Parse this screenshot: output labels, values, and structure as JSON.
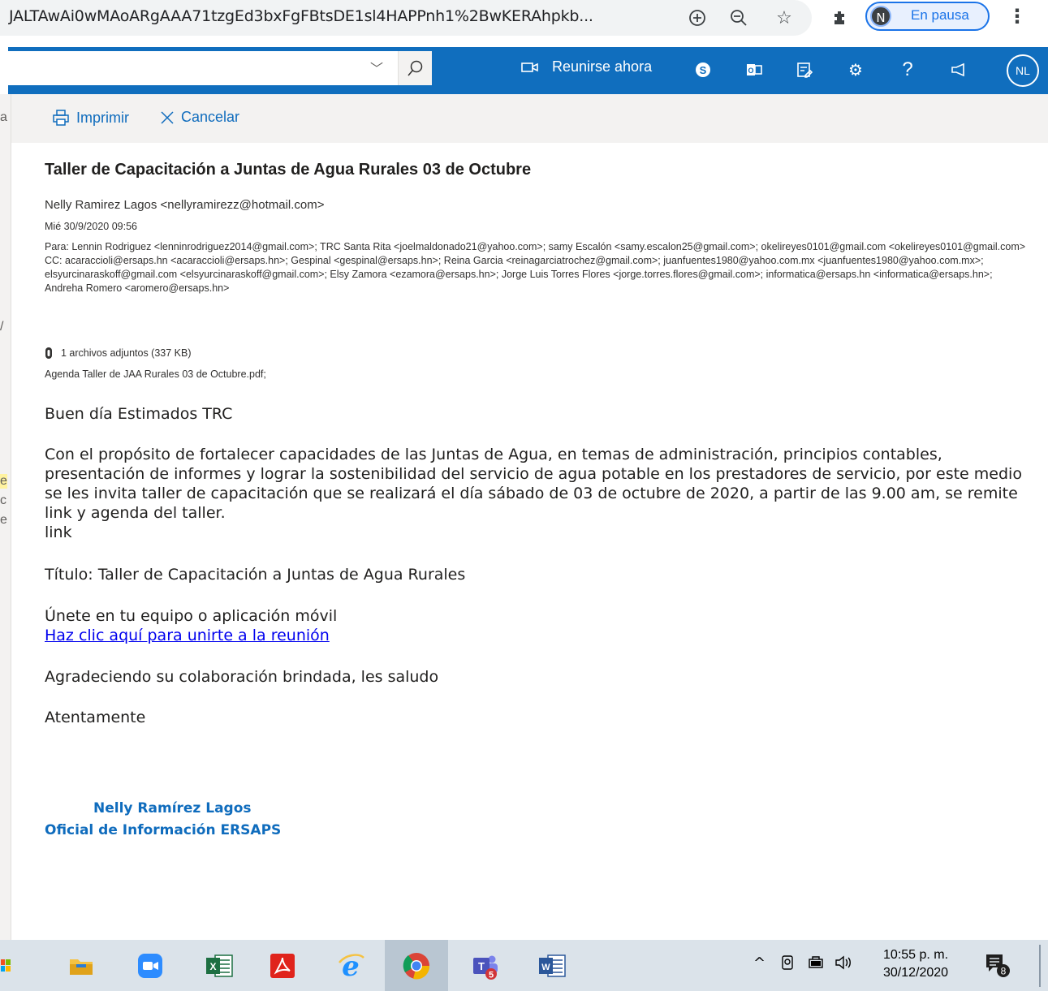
{
  "browser": {
    "url": "JALTAwAi0wMAoARgAAA71tzgEd3bxFgFBtsDE1sl4HAPPnh1%2BwKERAhpkb...",
    "profile_initial": "N",
    "profile_status": "En pausa"
  },
  "owa_header": {
    "meet_now": "Reunirse ahora",
    "help": "?",
    "avatar": "NL"
  },
  "left_strip": {
    "frag1": "a",
    "frag2": "/",
    "frag3": "e",
    "frag4": "c",
    "frag5": "e"
  },
  "toolbar": {
    "print_label": "Imprimir",
    "cancel_label": "Cancelar"
  },
  "message": {
    "subject": "Taller de Capacitación a Juntas de Agua Rurales 03 de Octubre",
    "from": "Nelly Ramirez Lagos <nellyramirezz@hotmail.com>",
    "date": "Mié 30/9/2020 09:56",
    "to": "Para:  Lennin Rodriguez <lenninrodriguez2014@gmail.com>; TRC Santa Rita <joelmaldonado21@yahoo.com>; samy Escalón <samy.escalon25@gmail.com>; okelireyes0101@gmail.com <okelireyes0101@gmail.com>",
    "cc": "CC:  acaraccioli@ersaps.hn <acaraccioli@ersaps.hn>; Gespinal <gespinal@ersaps.hn>; Reina Garcia <reinagarciatrochez@gmail.com>; juanfuentes1980@yahoo.com.mx <juanfuentes1980@yahoo.com.mx>; elsyurcinaraskoff@gmail.com <elsyurcinaraskoff@gmail.com>; Elsy Zamora <ezamora@ersaps.hn>; Jorge Luis Torres Flores <jorge.torres.flores@gmail.com>; informatica@ersaps.hn <informatica@ersaps.hn>; Andreha Romero <aromero@ersaps.hn>",
    "attachments_count": "1 archivos adjuntos (337 KB)",
    "attachment_name": "Agenda Taller de JAA Rurales 03 de Octubre.pdf;",
    "greeting": "Buen día Estimados TRC",
    "paragraph": "Con el propósito de fortalecer capacidades de las Juntas de Agua, en temas de administración, principios contables, presentación de informes y lograr la sostenibilidad del servicio de agua potable en los prestadores de servicio, por este medio se les invita taller de capacitación que se realizará el día sábado de 03 de octubre de 2020, a partir de las 9.00 am, se remite link y agenda del taller.",
    "link_word": "link",
    "title_line": "Título: Taller de Capacitación a Juntas de Agua Rurales",
    "join_text": "Únete en tu equipo o aplicación móvil",
    "join_link": "Haz clic aquí para unirte a la reunión",
    "thanks": "Agradeciendo su colaboración brindada, les saludo",
    "closing": "Atentamente",
    "sig_name": "Nelly Ramírez Lagos",
    "sig_title": "Oficial de Información ERSAPS"
  },
  "taskbar": {
    "teams_badge": "5",
    "time": "10:55 p. m.",
    "date": "30/12/2020",
    "notif_count": "8"
  },
  "colors": {
    "owa_blue": "#106ebe",
    "link_blue": "#0000ee",
    "signature_blue": "#0f6cbd"
  }
}
